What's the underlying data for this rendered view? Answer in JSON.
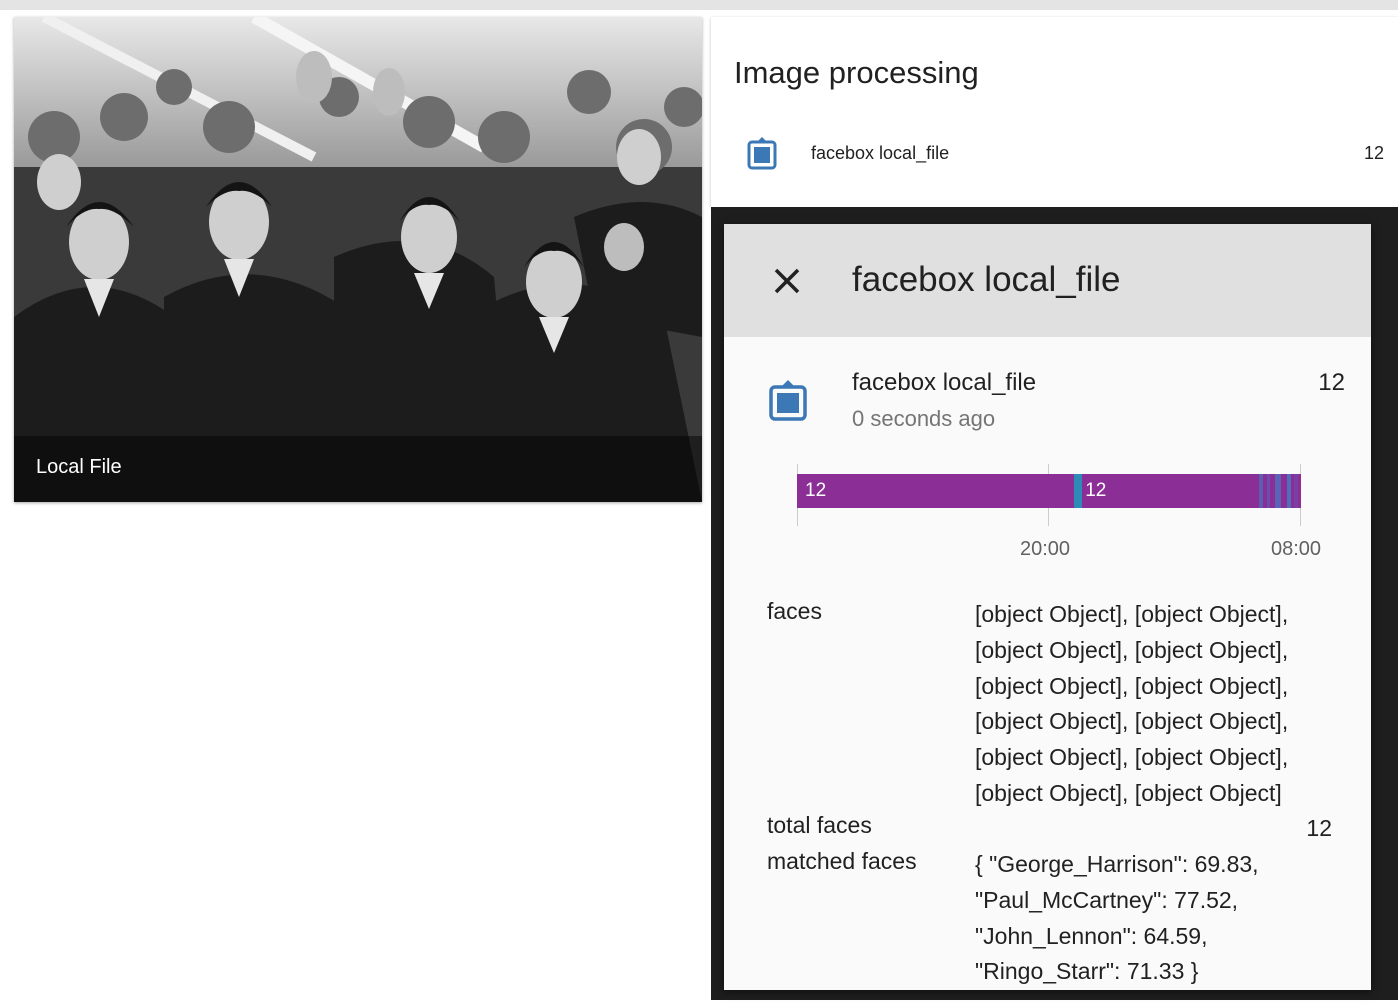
{
  "camera_card": {
    "caption": "Local File"
  },
  "processing_card": {
    "title": "Image processing",
    "entity": {
      "icon": "clipboard-icon",
      "name": "facebox local_file",
      "state": "12"
    }
  },
  "dialog": {
    "title": "facebox local_file",
    "close_icon": "close-icon",
    "entity": {
      "icon": "clipboard-icon",
      "name": "facebox local_file",
      "last_changed": "0 seconds ago",
      "state": "12"
    },
    "history": {
      "bar_color": "#8b2f97",
      "marker_color": "#2e8bb8",
      "segments": [
        {
          "label": "12",
          "start_fraction": 0.0
        },
        {
          "label": "12",
          "start_fraction": 0.556
        }
      ],
      "tick_labels": [
        "20:00",
        "08:00"
      ]
    },
    "attributes": [
      {
        "key": "faces",
        "value": "[object Object], [object Object],\n[object Object], [object Object],\n[object Object], [object Object],\n[object Object], [object Object],\n[object Object], [object Object],\n[object Object], [object Object]"
      },
      {
        "key": "total faces",
        "value": "12"
      },
      {
        "key": "matched faces",
        "value": "{ \"George_Harrison\": 69.83,\n\"Paul_McCartney\": 77.52,\n\"John_Lennon\": 64.59,\n\"Ringo_Starr\": 71.33 }"
      }
    ]
  },
  "colors": {
    "accent": "#3b78b5",
    "header_bg": "#e0e0e0",
    "bar": "#8b2f97"
  }
}
